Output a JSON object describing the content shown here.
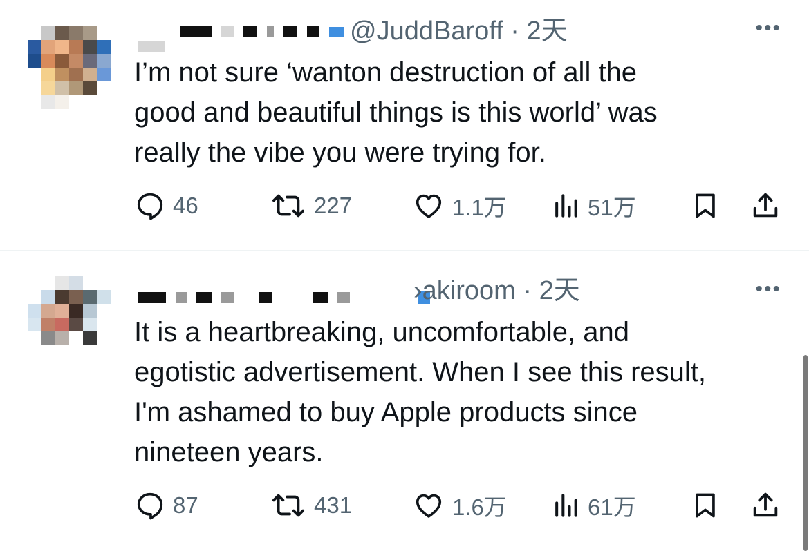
{
  "tweets": [
    {
      "handle": "@JuddBaroff",
      "time": "2天",
      "text": "I’m not sure ‘wanton destruction of all the\ngood and beautiful things is this world’ was\nreally the vibe you were trying for.",
      "stats": {
        "replies": "46",
        "retweets": "227",
        "likes": "1.1万",
        "views": "51万"
      }
    },
    {
      "handle": "›akiroom",
      "time": "2天",
      "text": "It is a heartbreaking, uncomfortable, and\negotistic advertisement. When I see this result,\nI'm ashamed to buy Apple products since\nnineteen years.",
      "stats": {
        "replies": "87",
        "retweets": "431",
        "likes": "1.6万",
        "views": "61万"
      }
    }
  ],
  "separator": " · ",
  "more_label": "•••",
  "icons": {
    "reply": "reply-icon",
    "retweet": "retweet-icon",
    "like": "heart-icon",
    "views": "views-icon",
    "bookmark": "bookmark-icon",
    "share": "share-icon",
    "verified": "verified-badge-icon"
  },
  "colors": {
    "text": "#0f1419",
    "secondary": "#536471",
    "accent": "#1d9bf0",
    "divider": "#eff3f4"
  }
}
